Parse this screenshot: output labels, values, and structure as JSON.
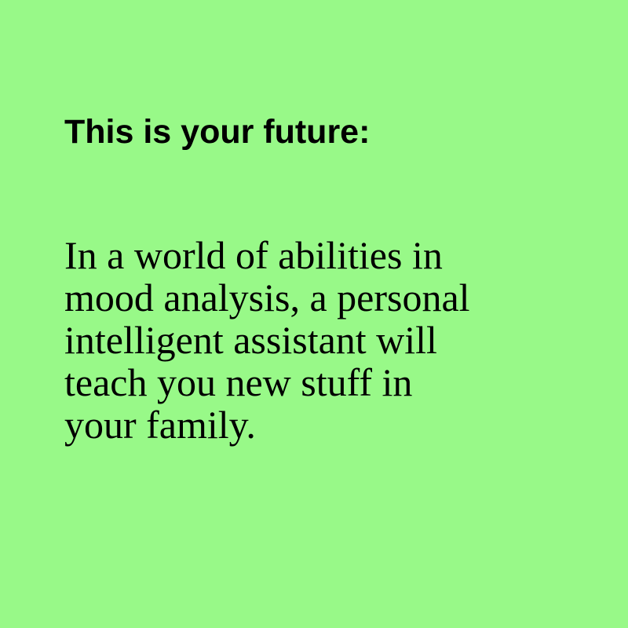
{
  "colors": {
    "background": "#98f988",
    "text": "#000000"
  },
  "heading": "This is your future:",
  "body_lines": [
    "In a world of abilities in",
    "mood analysis, a personal",
    "intelligent assistant will",
    "teach you new stuff in",
    "your family."
  ]
}
